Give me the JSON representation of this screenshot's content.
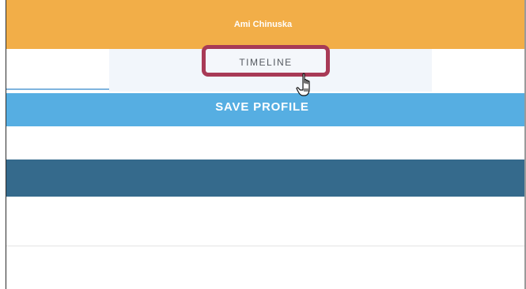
{
  "header": {
    "user_name": "Ami Chinuska"
  },
  "tabs": {
    "items": [
      {
        "label": "TIMELINE",
        "highlighted": true
      }
    ]
  },
  "profile": {
    "save_label": "SAVE PROFILE"
  },
  "colors": {
    "header_bg": "#f2ae48",
    "save_button_bg": "#56aee2",
    "dark_bar_bg": "#356a8c",
    "highlight_outline": "#a83a56"
  },
  "icons": {
    "cursor": "hand-pointer-icon"
  }
}
